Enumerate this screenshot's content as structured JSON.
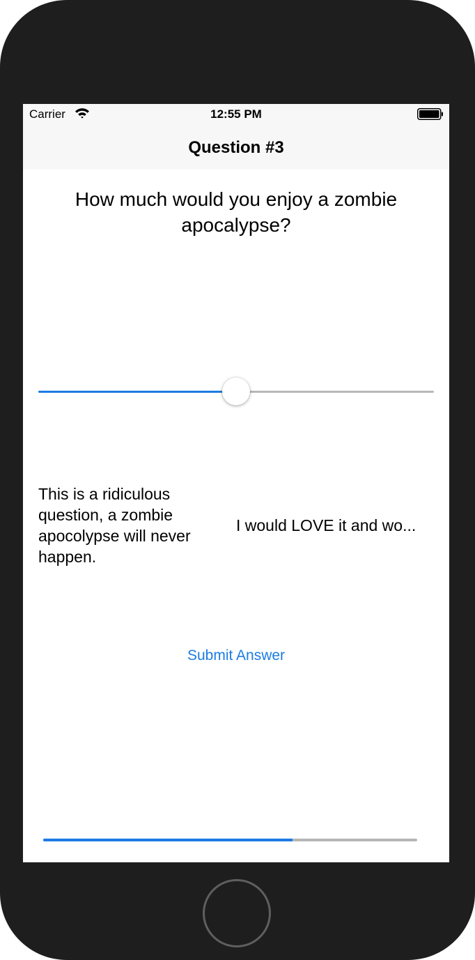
{
  "status_bar": {
    "carrier": "Carrier",
    "time": "12:55 PM",
    "wifi_icon": "wifi-icon",
    "battery_icon": "battery-icon"
  },
  "nav": {
    "title": "Question #3"
  },
  "question": {
    "text": "How much would you enjoy a zombie apocalypse?"
  },
  "slider": {
    "value": 0.5,
    "min_label": "This is a ridiculous question, a zombie apocolypse will never happen.",
    "max_label": "I would LOVE it and wo..."
  },
  "submit": {
    "label": "Submit Answer"
  },
  "progress": {
    "value": 0.667
  },
  "colors": {
    "accent": "#1b7ce4",
    "track": "#b7b7b7",
    "device": "#1e1e1e",
    "bar_background": "#f7f7f7"
  },
  "device": {
    "home_button_icon": "home-button-icon"
  }
}
